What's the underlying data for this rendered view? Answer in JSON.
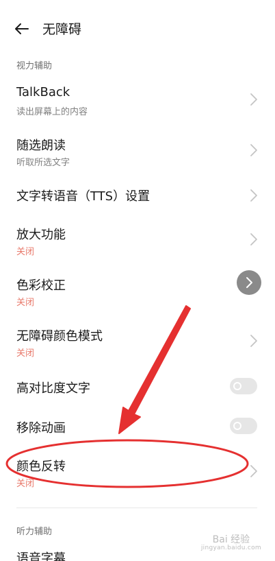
{
  "header": {
    "title": "无障碍",
    "back_icon": "arrow-left-icon"
  },
  "sections": {
    "vision": "视力辅助",
    "hearing": "听力辅助"
  },
  "items": {
    "talkback": {
      "title": "TalkBack",
      "subtitle": "读出屏幕上的内容"
    },
    "select_to_speak": {
      "title": "随选朗读",
      "subtitle": "听取所选文字"
    },
    "tts": {
      "title": "文字转语音（TTS）设置"
    },
    "magnification": {
      "title": "放大功能",
      "subtitle": "关闭"
    },
    "color_correction": {
      "title": "色彩校正",
      "subtitle": "关闭"
    },
    "accessible_color_mode": {
      "title": "无障碍颜色模式",
      "subtitle": "关闭"
    },
    "high_contrast_text": {
      "title": "高对比度文字",
      "toggle": false
    },
    "remove_animations": {
      "title": "移除动画",
      "toggle": false
    },
    "color_inversion": {
      "title": "颜色反转",
      "subtitle": "关闭"
    },
    "live_caption": {
      "title": "语音字幕"
    }
  },
  "watermark": {
    "text": "Bai 经验",
    "sub": "jingyan.baidu.com"
  },
  "colors": {
    "warn": "#e8786a",
    "annotation": "#e53030",
    "toggle_off": "#e6e6e6"
  }
}
